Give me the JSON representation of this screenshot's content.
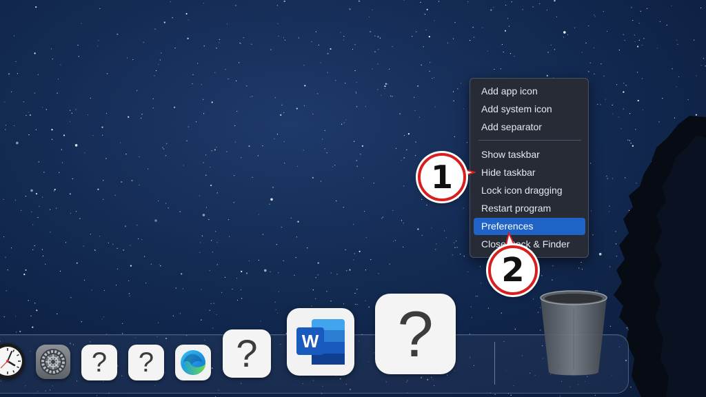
{
  "context_menu": {
    "group1": [
      {
        "label": "Add app icon"
      },
      {
        "label": "Add system icon"
      },
      {
        "label": "Add separator"
      }
    ],
    "group2": [
      {
        "label": "Show taskbar"
      },
      {
        "label": "Hide taskbar"
      },
      {
        "label": "Lock icon dragging"
      },
      {
        "label": "Restart program"
      },
      {
        "label": "Preferences",
        "highlighted": true
      },
      {
        "label": "Close Dock & Finder"
      }
    ],
    "highlight_color": "#1f63c6",
    "background_color": "#262b36"
  },
  "callouts": {
    "first": "1",
    "second": "2",
    "ring_color": "#d91e1e"
  },
  "dock": {
    "icons": [
      {
        "name": "clock-app-icon"
      },
      {
        "name": "system-preferences-icon"
      },
      {
        "name": "unknown-app-icon",
        "glyph": "?"
      },
      {
        "name": "unknown-app-icon",
        "glyph": "?"
      },
      {
        "name": "microsoft-edge-icon"
      },
      {
        "name": "unknown-app-icon",
        "glyph": "?"
      },
      {
        "name": "microsoft-word-icon",
        "letter": "W"
      },
      {
        "name": "unknown-app-icon",
        "glyph": "?"
      },
      {
        "name": "trash-icon"
      }
    ]
  },
  "wallpaper": {
    "description_colors": [
      "#1e3a6a",
      "#0b1b3a"
    ]
  }
}
